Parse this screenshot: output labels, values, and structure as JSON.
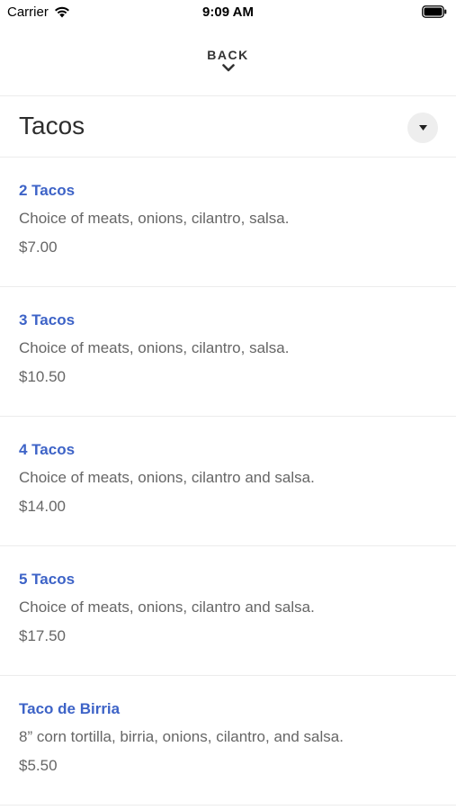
{
  "status_bar": {
    "carrier": "Carrier",
    "time": "9:09 AM"
  },
  "nav": {
    "back_label": "BACK"
  },
  "section": {
    "title": "Tacos"
  },
  "menu_items": [
    {
      "name": "2 Tacos",
      "description": "Choice of meats, onions, cilantro, salsa.",
      "price": "$7.00"
    },
    {
      "name": "3 Tacos",
      "description": "Choice of meats, onions, cilantro, salsa.",
      "price": "$10.50"
    },
    {
      "name": "4 Tacos",
      "description": "Choice of meats, onions, cilantro and salsa.",
      "price": "$14.00"
    },
    {
      "name": "5 Tacos",
      "description": "Choice of meats, onions, cilantro and salsa.",
      "price": "$17.50"
    },
    {
      "name": "Taco de Birria",
      "description": "8” corn tortilla, birria, onions, cilantro, and salsa.",
      "price": "$5.50"
    }
  ],
  "colors": {
    "item_name": "#3d63c7",
    "text_secondary": "#666666",
    "divider": "#ececec"
  }
}
